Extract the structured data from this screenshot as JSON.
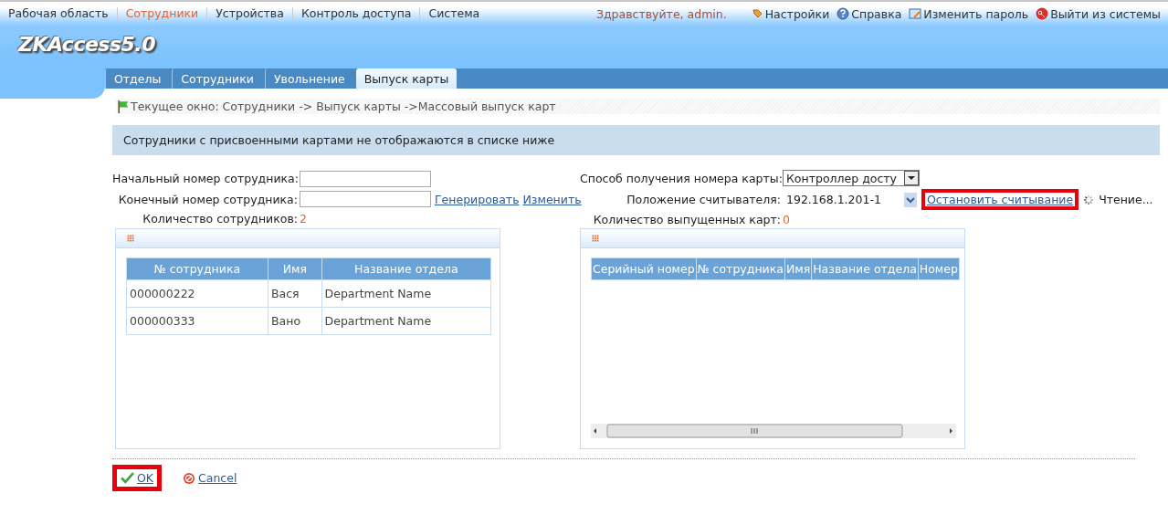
{
  "top_nav": {
    "items": [
      {
        "label": "Рабочая область",
        "selected": false
      },
      {
        "label": "Сотрудники",
        "selected": true
      },
      {
        "label": "Устройства",
        "selected": false
      },
      {
        "label": "Контроль доступа",
        "selected": false
      },
      {
        "label": "Система",
        "selected": false
      }
    ],
    "greeting": "Здравствуйте, admin.",
    "links": [
      {
        "kind": "settings",
        "label": "Настройки"
      },
      {
        "kind": "help",
        "label": "Справка"
      },
      {
        "kind": "password",
        "label": "Изменить пароль"
      },
      {
        "kind": "logout",
        "label": "Выйти из системы"
      }
    ]
  },
  "logo": "ZKAccess5.0",
  "tabs": [
    {
      "label": "Отделы",
      "selected": false
    },
    {
      "label": "Сотрудники",
      "selected": false
    },
    {
      "label": "Увольнение",
      "selected": false
    },
    {
      "label": "Выпуск карты",
      "selected": true
    }
  ],
  "breadcrumb": "Текущее окно: Сотрудники -> Выпуск карты ->Массовый выпуск карт",
  "notice": "Сотрудники с присвоенными картами не отображаются в списке ниже",
  "form": {
    "start_label": "Начальный номер сотрудника:",
    "end_label": "Конечный номер сотрудника:",
    "generate": "Генерировать",
    "change": "Изменить",
    "count_label": "Количество сотрудников:",
    "count": "2",
    "method_label": "Способ получения номера карты:",
    "method_value": "Контроллер досту",
    "reader_label": "Положение считывателя:",
    "reader_value": "192.168.1.201-1",
    "stop_link": {
      "label": "Остановить считывание",
      "highlighted": true
    },
    "status": "Чтение...",
    "issued_label": "Количество выпущенных карт:",
    "issued": "0"
  },
  "employees_table": {
    "columns": [
      "№ сотрудника",
      "Имя",
      "Название отдела"
    ],
    "rows": [
      [
        "000000222",
        "Вася",
        "Department Name"
      ],
      [
        "000000333",
        "Вано",
        "Department Name"
      ]
    ]
  },
  "issued_table": {
    "columns": [
      "Серийный номер",
      "№ сотрудника",
      "Имя",
      "Название отдела",
      "Номер"
    ]
  },
  "buttons": [
    {
      "kind": "ok",
      "label": "OK",
      "highlighted": true
    },
    {
      "kind": "cancel",
      "label": "Cancel",
      "highlighted": false
    }
  ]
}
